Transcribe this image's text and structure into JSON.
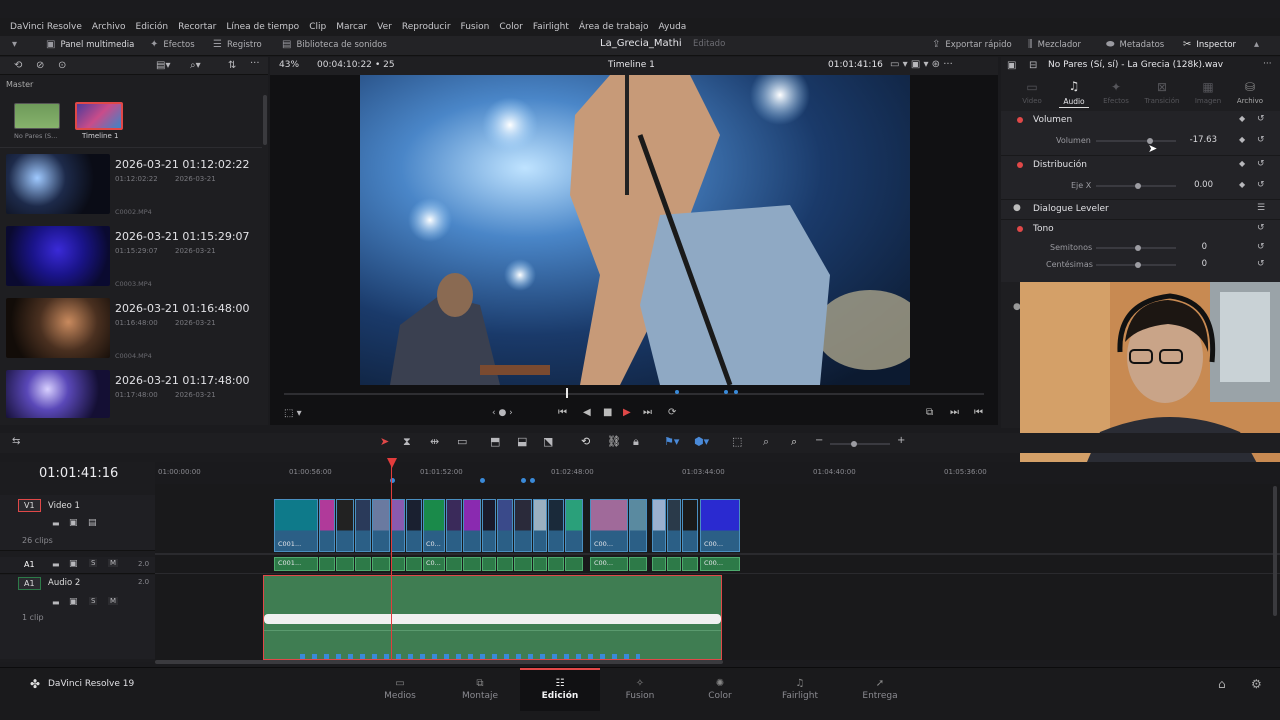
{
  "menu": [
    "DaVinci Resolve",
    "Archivo",
    "Edición",
    "Recortar",
    "Línea de tiempo",
    "Clip",
    "Marcar",
    "Ver",
    "Reproducir",
    "Fusion",
    "Color",
    "Fairlight",
    "Área de trabajo",
    "Ayuda"
  ],
  "toolbar": {
    "media_pool": "Panel multimedia",
    "effects": "Efectos",
    "index": "Registro",
    "sound_library": "Biblioteca de sonidos",
    "project_title": "La_Grecia_Mathi",
    "project_status": "Editado",
    "quick_export": "Exportar rápido",
    "mixer": "Mezclador",
    "metadata": "Metadatos",
    "inspector": "Inspector"
  },
  "viewer": {
    "zoom": "43%",
    "duration": "00:04:10:22",
    "fps": "25",
    "timeline_name": "Timeline 1",
    "timecode": "01:01:41:16"
  },
  "media_pool": {
    "bin": "Master",
    "top_items": [
      {
        "label": "No Pares (S..."
      },
      {
        "label": "Timeline 1"
      }
    ],
    "clips": [
      {
        "title": "2026-03-21  01:12:02:22",
        "tc": "01:12:02:22",
        "date": "2026-03-21",
        "file": "C0002.MP4"
      },
      {
        "title": "2026-03-21  01:15:29:07",
        "tc": "01:15:29:07",
        "date": "2026-03-21",
        "file": "C0003.MP4"
      },
      {
        "title": "2026-03-21  01:16:48:00",
        "tc": "01:16:48:00",
        "date": "2026-03-21",
        "file": "C0004.MP4"
      },
      {
        "title": "2026-03-21  01:17:48:00",
        "tc": "01:17:48:00",
        "date": "2026-03-21",
        "file": ""
      }
    ]
  },
  "inspector": {
    "clip_name": "No Pares (Sí, sí) - La Grecia (128k).wav",
    "tabs": [
      "Video",
      "Audio",
      "Efectos",
      "Transición",
      "Imagen",
      "Archivo"
    ],
    "active_tab": "Audio",
    "sections": {
      "volume": {
        "title": "Volumen",
        "param": "Volumen",
        "value": "-17.63"
      },
      "pan": {
        "title": "Distribución",
        "param": "Eje X",
        "value": "0.00"
      },
      "leveler": {
        "title": "Dialogue Leveler"
      },
      "pitch": {
        "title": "Tono",
        "semitones_label": "Semitonos",
        "semitones": "0",
        "cents_label": "Centésimas",
        "cents": "0"
      }
    }
  },
  "timeline": {
    "current_tc": "01:01:41:16",
    "ruler": [
      "01:00:00:00",
      "01:00:56:00",
      "01:01:52:00",
      "01:02:48:00",
      "01:03:44:00",
      "01:04:40:00",
      "01:05:36:00"
    ],
    "tracks": {
      "v1": {
        "id": "V1",
        "name": "Video 1",
        "count": "26 clips"
      },
      "a1": {
        "id": "A1",
        "name": "",
        "level": "2.0"
      },
      "a2": {
        "id": "A1",
        "name": "Audio 2",
        "level": "2.0",
        "count": "1 clip"
      }
    },
    "clip_labels": [
      "C001...",
      "C0...",
      "C00...",
      "C00..."
    ]
  },
  "pages": [
    "Medios",
    "Montaje",
    "Edición",
    "Fusion",
    "Color",
    "Fairlight",
    "Entrega"
  ],
  "active_page": "Edición",
  "brand": "DaVinci Resolve 19",
  "colors": {
    "accent_red": "#e04848",
    "video_clip": "#2b5f86",
    "audio_clip": "#2d7a48",
    "playhead": "#e23c3c"
  }
}
